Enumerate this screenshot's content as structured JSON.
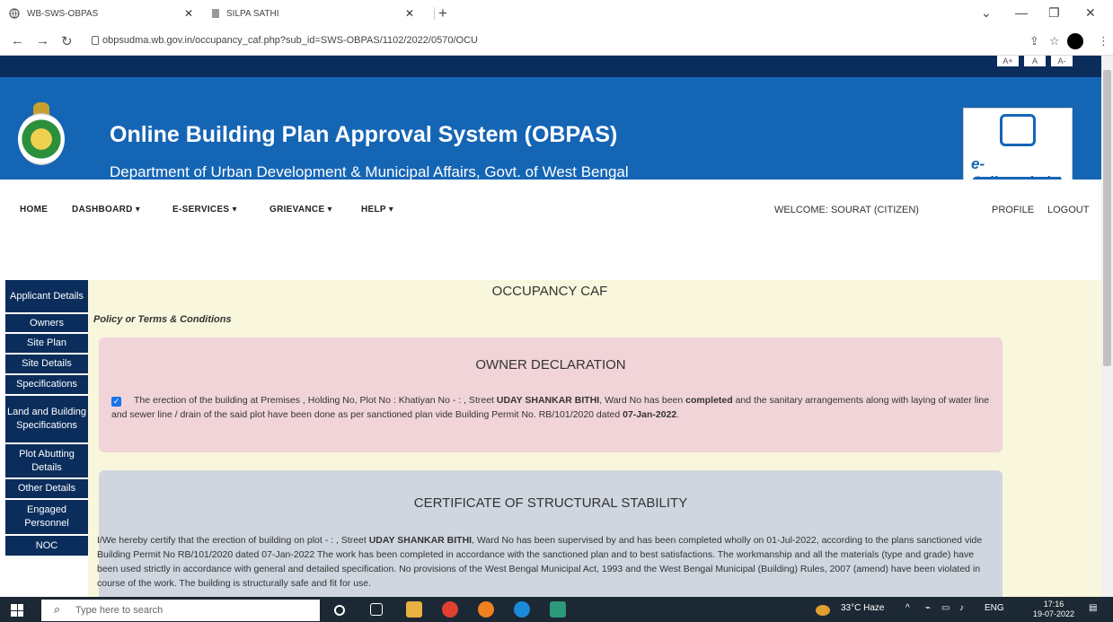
{
  "browser": {
    "tabs": [
      {
        "title": "WB-SWS-OBPAS"
      },
      {
        "title": "SILPA SATHI"
      }
    ],
    "url": "obpsudma.wb.gov.in/occupancy_caf.php?sub_id=SWS-OBPAS/1102/2022/0570/OCU"
  },
  "font_controls": [
    "A+",
    "A",
    "A-"
  ],
  "banner": {
    "title": "Online Building Plan Approval System (OBPAS)",
    "subtitle": "Department of Urban Development & Municipal Affairs, Govt. of West Bengal",
    "logo_text": "e-Grihanaksha"
  },
  "menu": {
    "items": [
      "HOME",
      "DASHBOARD ▾",
      "E-SERVICES ▾",
      "GRIEVANCE ▾",
      "HELP ▾"
    ],
    "welcome": "WELCOME: SOURAT (CITIZEN)",
    "profile": "PROFILE",
    "logout": "LOGOUT"
  },
  "sidebar": {
    "items": [
      "Applicant Details",
      "Owners",
      "Site Plan",
      "Site Details",
      "Specifications",
      "Land and Building Specifications",
      "Plot Abutting Details",
      "Other Details",
      "Engaged Personnel",
      "NOC"
    ]
  },
  "content": {
    "title": "OCCUPANCY CAF",
    "policy_label": "Policy or Terms & Conditions",
    "owner_declaration": {
      "heading": "OWNER DECLARATION",
      "checked": true,
      "text_1": "The erection of the building at Premises , Holding No, Plot No : Khatiyan No - : , Street ",
      "street": "UDAY SHANKAR BITHI",
      "text_2": ", Ward No has been ",
      "completed": "completed",
      "text_3": " and the sanitary arrangements along with laying of water line and sewer line / drain of the said plot have been done as per sanctioned plan vide Building Permit No. RB/101/2020 dated ",
      "date": "07-Jan-2022",
      "text_4": "."
    },
    "structural_stability": {
      "heading": "CERTIFICATE OF STRUCTURAL STABILITY",
      "text_1": "I/We hereby certify that the erection of building on plot - : , Street ",
      "street": "UDAY SHANKAR BITHI",
      "text_2": ", Ward No has been supervised by and has been completed wholly on 01-Jul-2022, according to the plans sanctioned vide Building Permit No RB/101/2020 dated 07-Jan-2022 The work has been completed in accordance with the sanctioned plan and to best satisfactions. The workmanship and all the materials (type and grade) have been used strictly in accordance with general and detailed specification. No provisions of the West Bengal Municipal Act, 1993 and the West Bengal Municipal (Building) Rules, 2007 (amend) have been violated in course of the work. The building is structurally safe and fit for use."
    }
  },
  "taskbar": {
    "search_placeholder": "Type here to search",
    "weather": "33°C Haze",
    "language": "ENG",
    "time": "17:16",
    "date": "19-07-2022"
  },
  "colors": {
    "banner_blue": "#1565b5",
    "nav_dark": "#0a2d5c",
    "declaration_bg": "#f1d4d8",
    "certificate_bg": "#cfd6df",
    "content_bg": "#f8f6dc"
  }
}
